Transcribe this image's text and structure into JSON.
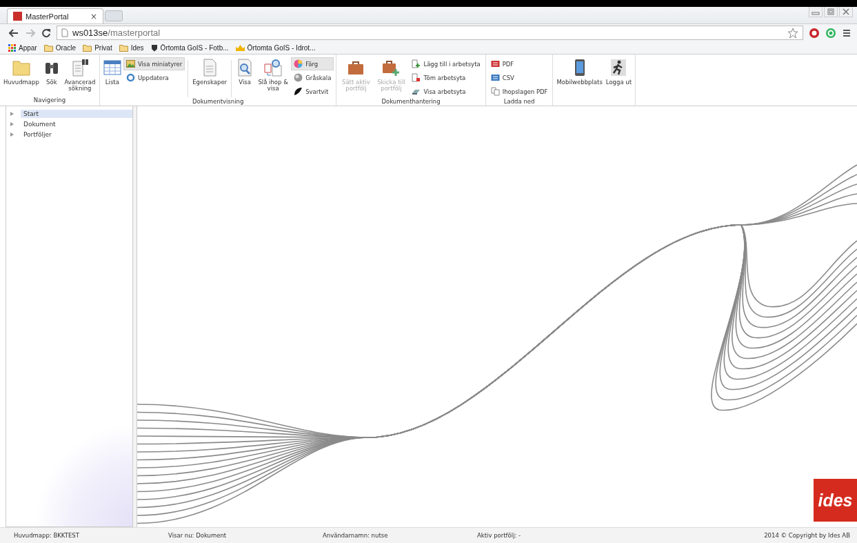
{
  "browser": {
    "tab": {
      "title": "MasterPortal",
      "close": "×"
    },
    "url": {
      "host": "ws013se",
      "path": "/masterportal"
    },
    "bookmarks": [
      {
        "kind": "apps",
        "label": "Appar"
      },
      {
        "kind": "folder",
        "label": "Oracle"
      },
      {
        "kind": "folder",
        "label": "Privat"
      },
      {
        "kind": "folder",
        "label": "Ides"
      },
      {
        "kind": "shield",
        "label": "Örtomta GoIS - Fotb..."
      },
      {
        "kind": "crown",
        "label": "Örtomta GoIS - Idrot..."
      }
    ]
  },
  "ribbon": {
    "groups": [
      {
        "label": "Navigering",
        "items": [
          {
            "kind": "large",
            "label": "Huvudmapp",
            "disabled": false
          },
          {
            "kind": "large",
            "label": "Sök",
            "disabled": false
          },
          {
            "kind": "large",
            "label": "Avancerad sökning",
            "disabled": false
          }
        ]
      },
      {
        "label": "Dokumentvisning",
        "items": [
          {
            "kind": "large",
            "label": "Lista",
            "disabled": false
          },
          {
            "kind": "stack",
            "entries": [
              {
                "label": "Visa miniatyrer",
                "selected": true
              },
              {
                "label": "Uppdatera",
                "selected": false
              }
            ]
          },
          {
            "kind": "separator"
          },
          {
            "kind": "large",
            "label": "Egenskaper",
            "disabled": false
          },
          {
            "kind": "separator"
          },
          {
            "kind": "large",
            "label": "Visa",
            "disabled": false
          },
          {
            "kind": "large",
            "label": "Slå ihop & visa",
            "disabled": false
          },
          {
            "kind": "stack",
            "entries": [
              {
                "label": "Färg",
                "selected": true
              },
              {
                "label": "Gråskala",
                "selected": false
              },
              {
                "label": "Svartvit",
                "selected": false
              }
            ]
          }
        ]
      },
      {
        "label": "Dokumenthantering",
        "items": [
          {
            "kind": "large",
            "label": "Sätt aktiv portfölj",
            "disabled": true
          },
          {
            "kind": "large",
            "label": "Skicka till portfölj",
            "disabled": true
          },
          {
            "kind": "stack",
            "entries": [
              {
                "label": "Lägg till i arbetsyta",
                "selected": false
              },
              {
                "label": "Töm arbetsyta",
                "selected": false
              },
              {
                "label": "Visa arbetsyta",
                "selected": false
              }
            ]
          }
        ]
      },
      {
        "label": "Ladda ned",
        "items": [
          {
            "kind": "stack",
            "entries": [
              {
                "label": "PDF",
                "selected": false
              },
              {
                "label": "CSV",
                "selected": false
              },
              {
                "label": "Ihopslagen PDF",
                "selected": false
              }
            ]
          }
        ]
      },
      {
        "items": [
          {
            "kind": "large",
            "label": "Mobilwebbplats",
            "disabled": false
          },
          {
            "kind": "large",
            "label": "Logga ut",
            "disabled": false
          }
        ]
      }
    ]
  },
  "sidebar": {
    "items": [
      {
        "label": "Start",
        "selected": true,
        "expanded": false
      },
      {
        "label": "Dokument",
        "selected": false,
        "expanded": false
      },
      {
        "label": "Portföljer",
        "selected": false,
        "expanded": false
      }
    ]
  },
  "logo": {
    "text": "ides"
  },
  "status_bar": [
    "Huvudmapp: BKKTEST",
    "Visar nu: Dokument",
    "Användarnamn: nutse",
    "Aktiv portfölj: -",
    "2014 © Copyright by Ides AB"
  ]
}
